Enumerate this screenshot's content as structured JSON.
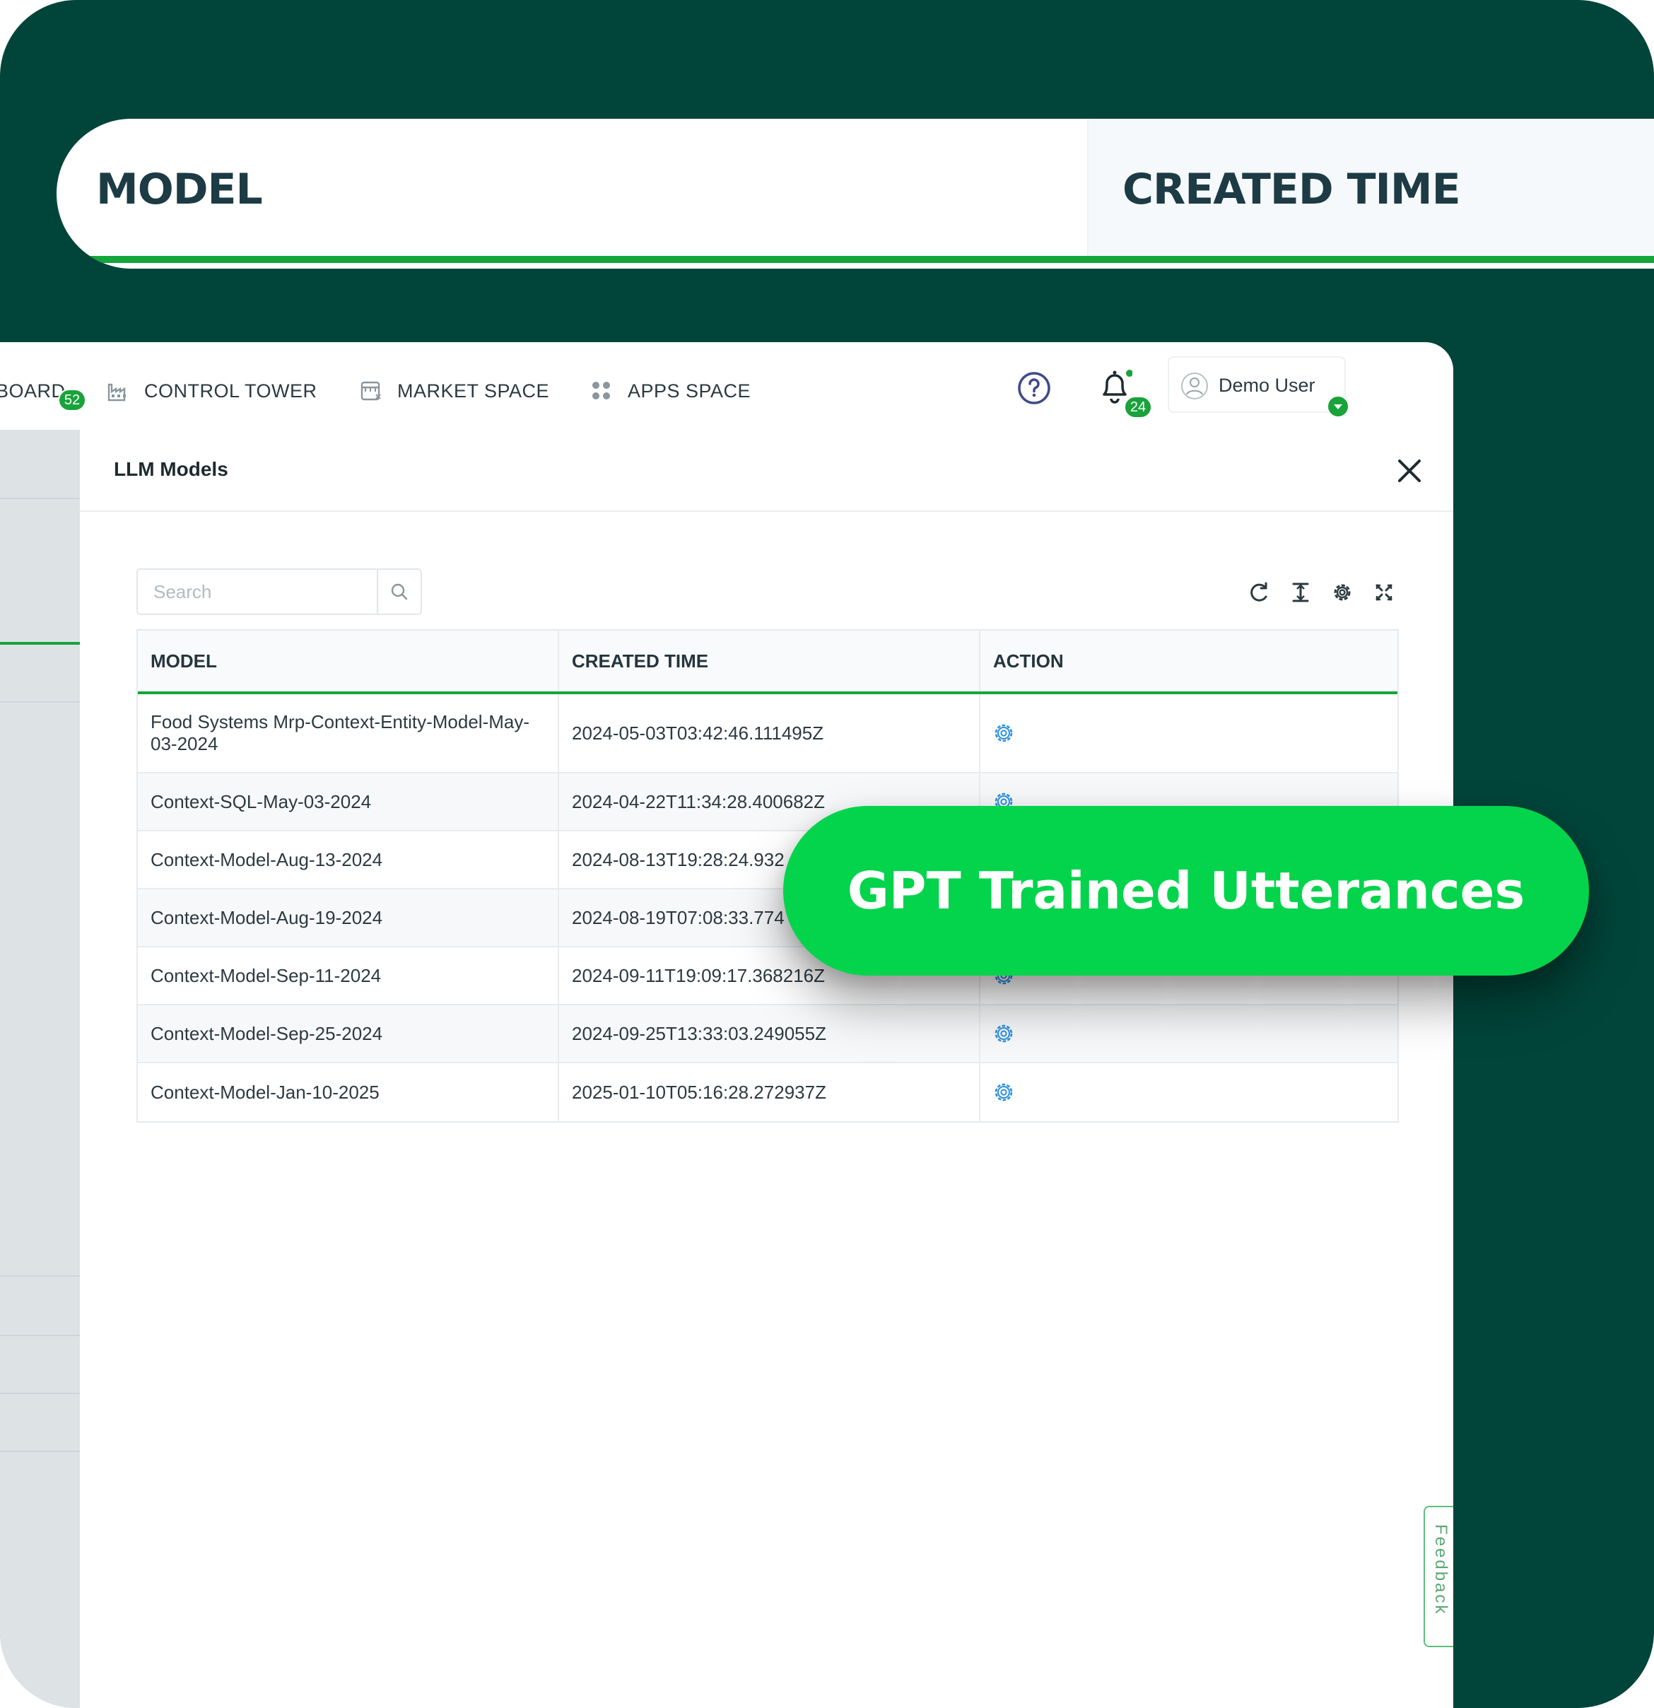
{
  "zoom_header": {
    "col1": "MODEL",
    "col2": "CREATED TIME"
  },
  "nav": {
    "items": [
      {
        "label": "BOARD",
        "badge": "52",
        "icon": "dashboard-icon"
      },
      {
        "label": "CONTROL TOWER",
        "icon": "factory-icon"
      },
      {
        "label": "MARKET SPACE",
        "icon": "store-icon"
      },
      {
        "label": "APPS SPACE",
        "icon": "apps-grid-icon"
      }
    ],
    "help_icon": "help-circle-icon",
    "notifications": {
      "icon": "bell-icon",
      "count": "24"
    },
    "user": {
      "name": "Demo User",
      "icon": "user-avatar-icon"
    }
  },
  "panel": {
    "title": "LLM Models",
    "search_placeholder": "Search",
    "toolbar": [
      "refresh-icon",
      "column-height-icon",
      "settings-icon",
      "fullscreen-icon"
    ],
    "table": {
      "headers": [
        "MODEL",
        "CREATED TIME",
        "ACTION"
      ],
      "rows": [
        {
          "model": "Food Systems Mrp-Context-Entity-Model-May-03-2024",
          "created": "2024-05-03T03:42:46.111495Z"
        },
        {
          "model": "Context-SQL-May-03-2024",
          "created": "2024-04-22T11:34:28.400682Z"
        },
        {
          "model": "Context-Model-Aug-13-2024",
          "created": "2024-08-13T19:28:24.932"
        },
        {
          "model": "Context-Model-Aug-19-2024",
          "created": "2024-08-19T07:08:33.774"
        },
        {
          "model": "Context-Model-Sep-11-2024",
          "created": "2024-09-11T19:09:17.368216Z"
        },
        {
          "model": "Context-Model-Sep-25-2024",
          "created": "2024-09-25T13:33:03.249055Z"
        },
        {
          "model": "Context-Model-Jan-10-2025",
          "created": "2025-01-10T05:16:28.272937Z"
        }
      ]
    }
  },
  "feedback_label": "Feedback",
  "callout": "GPT Trained Utterances",
  "colors": {
    "background": "#01453a",
    "accent_green": "#14a53c",
    "callout_green": "#03d44c",
    "gear_blue": "#2a8fe0"
  }
}
